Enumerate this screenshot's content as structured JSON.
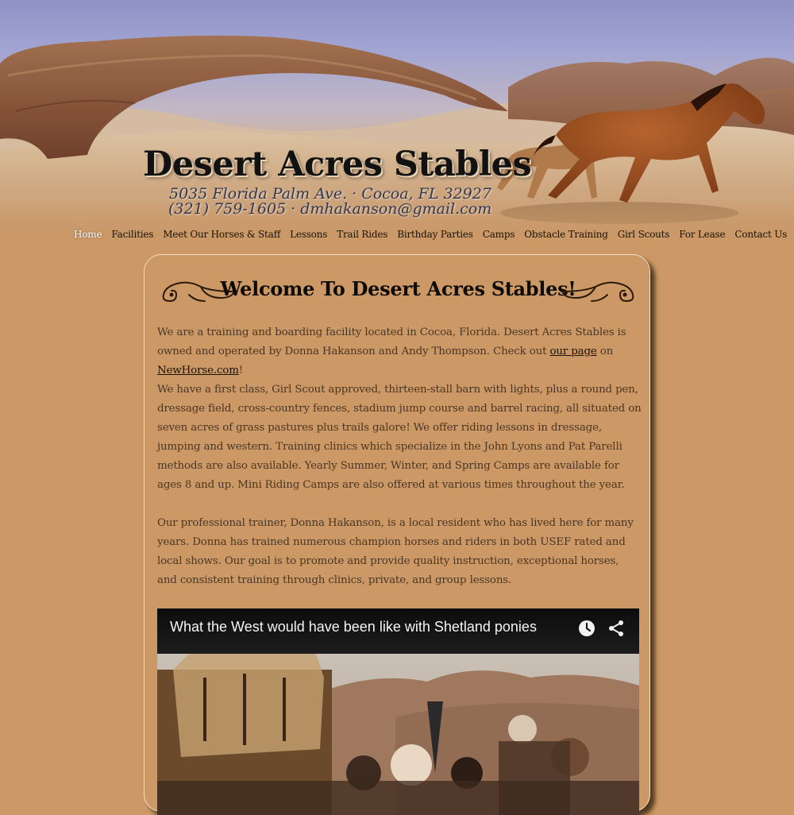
{
  "site": {
    "title": "Desert Acres Stables",
    "address_street": "5035 Florida Palm Ave.",
    "address_city": "Cocoa, FL 32927",
    "phone": "(321) 759-1605",
    "email": "dmhakanson@gmail.com",
    "separator": "·"
  },
  "nav": {
    "items": [
      {
        "label": "Home",
        "active": true
      },
      {
        "label": "Facilities"
      },
      {
        "label": "Meet Our Horses & Staff"
      },
      {
        "label": "Lessons"
      },
      {
        "label": "Trail Rides"
      },
      {
        "label": "Birthday Parties"
      },
      {
        "label": "Camps"
      },
      {
        "label": "Obstacle Training"
      },
      {
        "label": "Girl Scouts"
      },
      {
        "label": "For Lease"
      },
      {
        "label": "Contact Us"
      }
    ]
  },
  "content": {
    "heading": "Welcome To Desert Acres Stables!",
    "para1_text": "We are a training and boarding facility located in Cocoa, Florida. Desert Acres Stables is owned and operated by Donna Hakanson and Andy Thompson. Check out ",
    "para1_link1": "our page",
    "para1_mid": " on ",
    "para1_link2": "NewHorse.com",
    "para1_end": "!",
    "para2": "We have a first class, Girl Scout approved, thirteen-stall barn with lights, plus a round pen, dressage field, cross-country fences, stadium jump course and barrel racing, all situated on seven acres of grass pastures plus trails galore! We offer riding lessons in dressage, jumping and western. Training clinics which specialize in the John Lyons and Pat Parelli methods are also available. Yearly Summer, Winter, and Spring Camps are available for ages 8 and up. Mini Riding Camps are also offered at various times throughout the year.",
    "para3": "Our professional trainer, Donna Hakanson, is a local resident who has lived here for many years. Donna has trained numerous champion horses and riders in both USEF rated and local shows. Our goal is to promote and provide quality instruction, exceptional horses, and consistent training through clinics, private, and group lessons."
  },
  "video": {
    "title": "What the West would have been like with Shetland ponies",
    "icons": [
      "watch-later-icon",
      "share-icon"
    ]
  },
  "colors": {
    "background": "#cc9966",
    "nav_active": "#ffffff",
    "text": "#4a3624",
    "video_bar": "#151515"
  }
}
